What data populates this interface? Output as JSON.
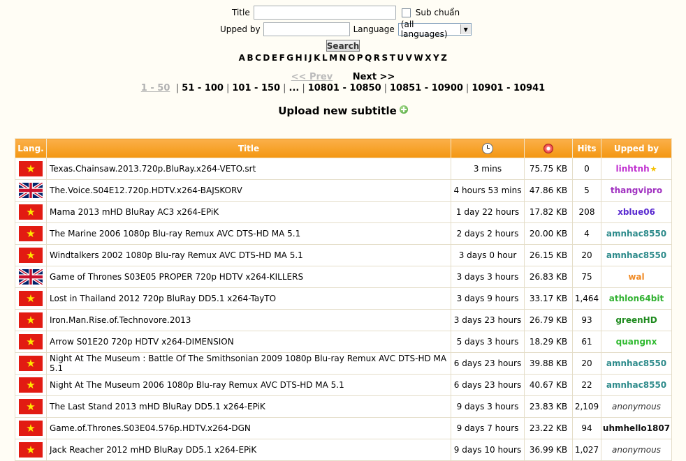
{
  "search": {
    "title_label": "Title",
    "title_value": "",
    "sub_chuan_label": "Sub chuẩn",
    "upped_by_label": "Upped by",
    "upped_by_value": "",
    "language_label": "Language",
    "language_selected": "(all languages)",
    "search_button": "Search"
  },
  "alphabet": [
    "A",
    "B",
    "C",
    "D",
    "E",
    "F",
    "G",
    "H",
    "I",
    "J",
    "K",
    "L",
    "M",
    "N",
    "O",
    "P",
    "Q",
    "R",
    "S",
    "T",
    "U",
    "V",
    "W",
    "X",
    "Y",
    "Z"
  ],
  "pagination": {
    "prev": "<< Prev",
    "next": "Next >>",
    "current": "1 - 50",
    "pages": [
      "51 - 100",
      "101 - 150",
      "...",
      "10801 - 10850",
      "10851 - 10900",
      "10901 - 10941"
    ]
  },
  "upload_label": "Upload new subtitle",
  "table": {
    "headers": {
      "lang": "Lang.",
      "title": "Title",
      "time": "clock-icon",
      "size": "disk-icon",
      "hits": "Hits",
      "user": "Upped by"
    },
    "rows": [
      {
        "flag": "vn",
        "title": "Texas.Chainsaw.2013.720p.BluRay.x264-VETO.srt",
        "time": "3 mins",
        "size": "75.75 KB",
        "hits": "0",
        "user": "linhtnh",
        "user_color": "#c030d0",
        "star": true
      },
      {
        "flag": "uk",
        "title": "The.Voice.S04E12.720p.HDTV.x264-BAJSKORV",
        "time": "4 hours 53 mins",
        "size": "47.86 KB",
        "hits": "5",
        "user": "thangvipro",
        "user_color": "#a030c0"
      },
      {
        "flag": "vn",
        "title": "Mama 2013 mHD BluRay AC3 x264-EPiK",
        "time": "1 day 22 hours",
        "size": "17.82 KB",
        "hits": "208",
        "user": "xblue06",
        "user_color": "#5a2bd0"
      },
      {
        "flag": "vn",
        "title": "The Marine 2006 1080p Blu-ray Remux AVC DTS-HD MA 5.1",
        "time": "2 days 2 hours",
        "size": "20.00 KB",
        "hits": "4",
        "user": "amnhac8550",
        "user_color": "#2e8b8b"
      },
      {
        "flag": "vn",
        "title": "Windtalkers 2002 1080p Blu-ray Remux AVC DTS-HD MA 5.1",
        "time": "3 days 0 hour",
        "size": "26.15 KB",
        "hits": "20",
        "user": "amnhac8550",
        "user_color": "#2e8b8b"
      },
      {
        "flag": "uk",
        "title": "Game of Thrones S03E05 PROPER 720p HDTV x264-KILLERS",
        "time": "3 days 3 hours",
        "size": "26.83 KB",
        "hits": "75",
        "user": "wal",
        "user_color": "#f08a24"
      },
      {
        "flag": "vn",
        "title": "Lost in Thailand 2012 720p BluRay DD5.1 x264-TayTO",
        "time": "3 days 9 hours",
        "size": "33.17 KB",
        "hits": "1,464",
        "user": "athlon64bit",
        "user_color": "#33b233"
      },
      {
        "flag": "vn",
        "title": "Iron.Man.Rise.of.Technovore.2013",
        "time": "3 days 23 hours",
        "size": "26.79 KB",
        "hits": "93",
        "user": "greenHD",
        "user_color": "#1e8a1e"
      },
      {
        "flag": "vn",
        "title": "Arrow S01E20 720p HDTV x264-DIMENSION",
        "time": "5 days 3 hours",
        "size": "18.29 KB",
        "hits": "61",
        "user": "quangnx",
        "user_color": "#33bb33"
      },
      {
        "flag": "vn",
        "title": "Night At The Museum : Battle Of The Smithsonian 2009 1080p Blu-ray Remux AVC DTS-HD MA 5.1",
        "time": "6 days 23 hours",
        "size": "39.88 KB",
        "hits": "20",
        "user": "amnhac8550",
        "user_color": "#2e8b8b"
      },
      {
        "flag": "vn",
        "title": "Night At The Museum 2006 1080p Blu-ray Remux AVC DTS-HD MA 5.1",
        "time": "6 days 23 hours",
        "size": "40.67 KB",
        "hits": "22",
        "user": "amnhac8550",
        "user_color": "#2e8b8b"
      },
      {
        "flag": "vn",
        "title": "The Last Stand 2013 mHD BluRay DD5.1 x264-EPiK",
        "time": "9 days 3 hours",
        "size": "23.83 KB",
        "hits": "2,109",
        "user": "anonymous",
        "user_color": "#333333",
        "anon": true
      },
      {
        "flag": "vn",
        "title": "Game.of.Thrones.S03E04.576p.HDTV.x264-DGN",
        "time": "9 days 7 hours",
        "size": "23.22 KB",
        "hits": "94",
        "user": "uhmhello1807",
        "user_color": "#111111"
      },
      {
        "flag": "vn",
        "title": "Jack Reacher 2012 mHD BluRay DD5.1 x264-EPiK",
        "time": "9 days 10 hours",
        "size": "36.99 KB",
        "hits": "1,027",
        "user": "anonymous",
        "user_color": "#333333",
        "anon": true
      }
    ]
  }
}
